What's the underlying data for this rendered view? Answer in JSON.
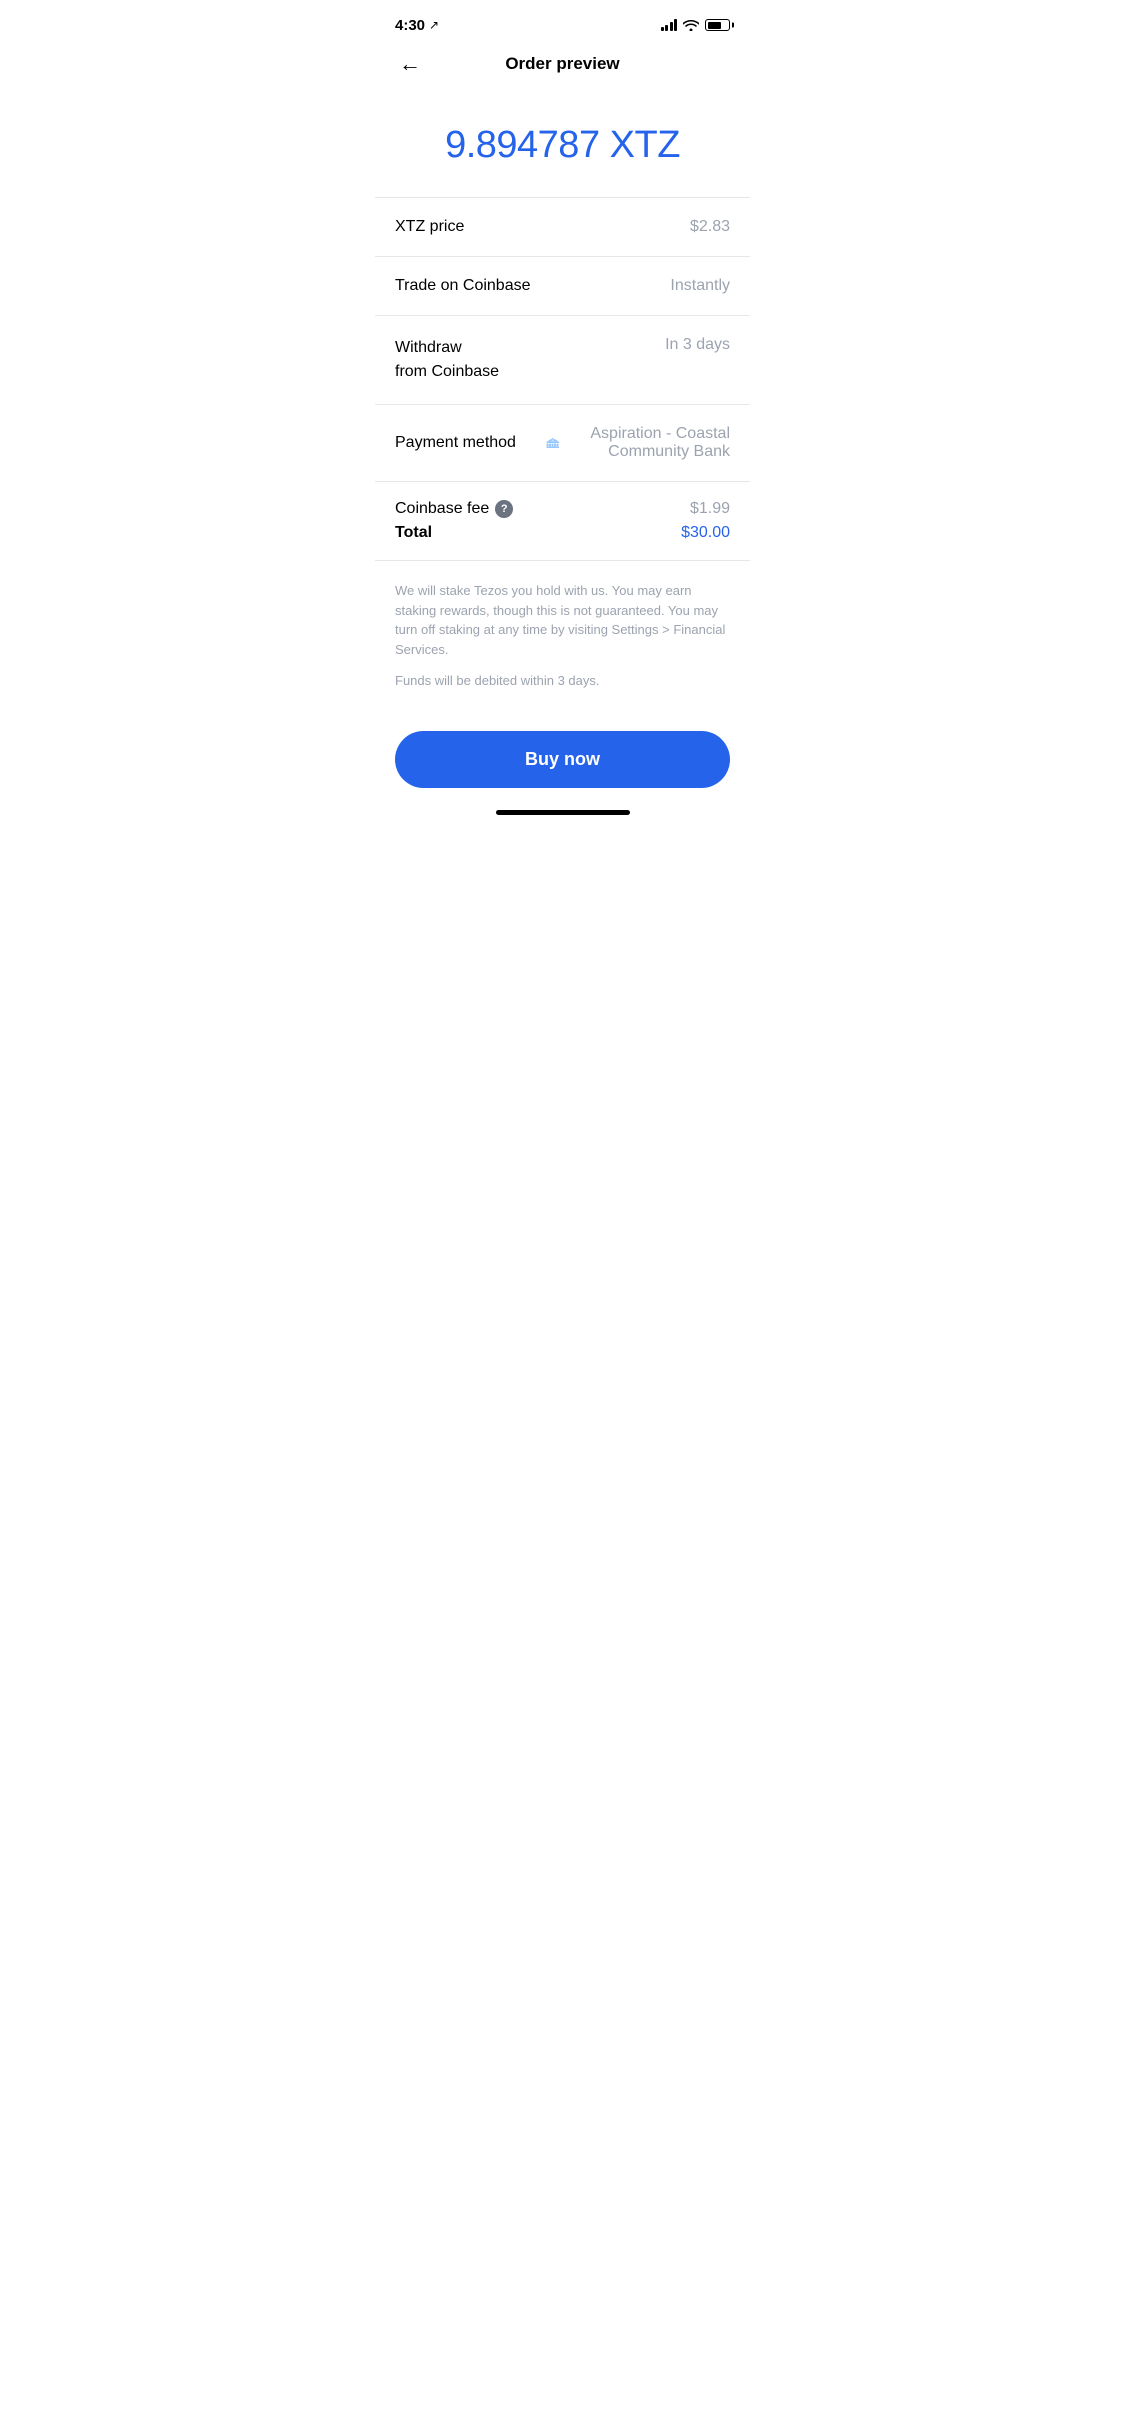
{
  "statusBar": {
    "time": "4:30",
    "locationIcon": "↗"
  },
  "nav": {
    "title": "Order preview",
    "backLabel": "←"
  },
  "amount": {
    "value": "9.894787 XTZ",
    "color": "#2563eb"
  },
  "rows": [
    {
      "id": "xtz-price",
      "label": "XTZ price",
      "value": "$2.83"
    },
    {
      "id": "trade",
      "label": "Trade on Coinbase",
      "value": "Instantly"
    },
    {
      "id": "withdraw",
      "label": "Withdraw\nfrom Coinbase",
      "value": "In 3 days"
    }
  ],
  "paymentMethod": {
    "label": "Payment method",
    "bankName": "Aspiration - Coastal Community Bank"
  },
  "fee": {
    "label": "Coinbase fee",
    "helpIcon": "?",
    "value": "$1.99"
  },
  "total": {
    "label": "Total",
    "value": "$30.00"
  },
  "disclaimer": {
    "staking": "We will stake Tezos you hold with us. You may earn staking rewards, though this is not guaranteed. You may turn off staking at any time by visiting Settings > Financial Services.",
    "debit": "Funds will be debited within 3 days."
  },
  "buyButton": {
    "label": "Buy now"
  }
}
